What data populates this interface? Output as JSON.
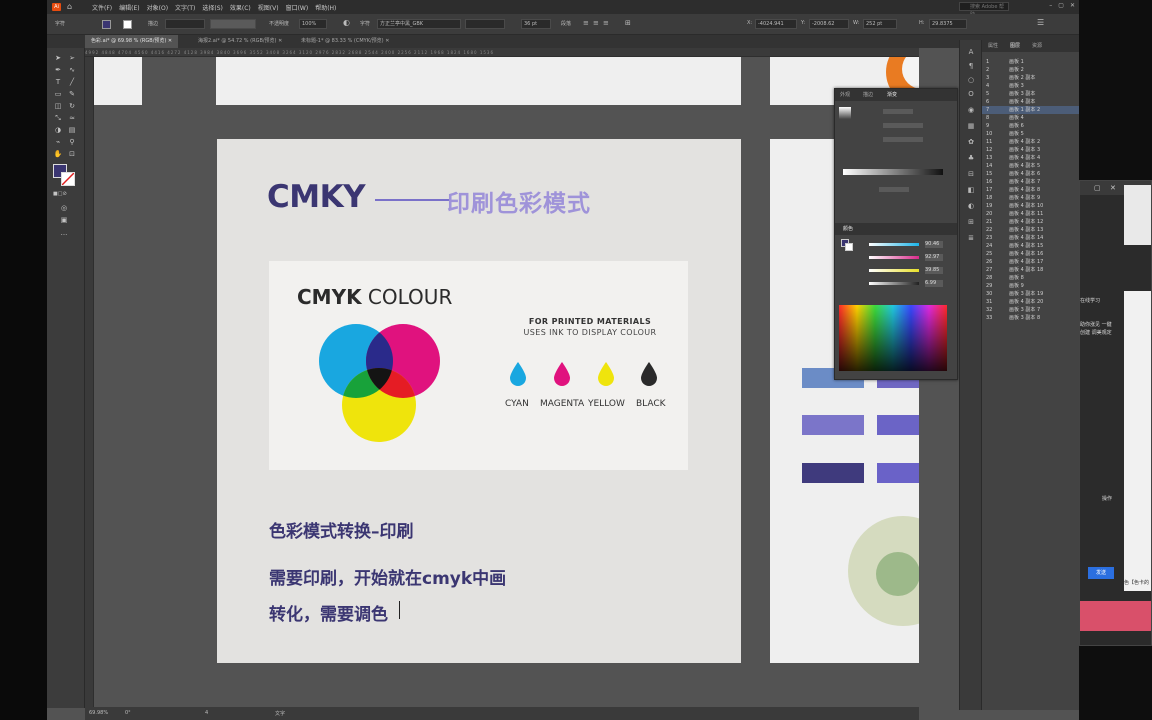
{
  "app": {
    "menus": [
      "文件(F)",
      "编辑(E)",
      "对象(O)",
      "文字(T)",
      "选择(S)",
      "效果(C)",
      "视图(V)",
      "窗口(W)",
      "帮助(H)"
    ],
    "search_placeholder": "搜索 Adobe 帮助",
    "control_bar": {
      "type_label": "字符",
      "stroke_label": "描边",
      "opacity_label": "不透明度",
      "opacity_value": "100%",
      "char_label": "字符",
      "font_value": "方正兰亭中黑_GBK",
      "font_size": "36 pt",
      "paragraph_label": "段落",
      "x_value": "-4024.941",
      "y_value": "-2008.62",
      "w_value": "252 pt",
      "h_value": "29.8375"
    },
    "tabs": [
      {
        "label": "色彩.ai* @ 69.98 % (RGB/预览)",
        "active": true
      },
      {
        "label": "海报2.ai* @ 54.72 % (RGB/预览)",
        "active": false
      },
      {
        "label": "未标题-1* @ 83.33 % (CMYK/预览)",
        "active": false
      }
    ],
    "ruler_ticks": "4992 4848 4704 4560 4416 4272 4128 3984 3840 3696 3552 3408 3264 3120 2976 2832 2688 2544 2400 2256 2112 1968 1824 1680 1536",
    "status": {
      "zoom": "69.98%",
      "angle": "0°",
      "page": "4",
      "mode": "文字"
    }
  },
  "artboard": {
    "title_en": "CMKY",
    "title_cn": "印刷色彩模式",
    "card": {
      "heading_bold": "CMYK",
      "heading_light": " COLOUR",
      "printed": "FOR PRINTED MATERIALS",
      "uses": "USES INK TO DISPLAY COLOUR",
      "drops": [
        {
          "label": "CYAN",
          "color": "#19a7e0"
        },
        {
          "label": "MAGENTA",
          "color": "#e0127e"
        },
        {
          "label": "YELLOW",
          "color": "#efe40c"
        },
        {
          "label": "BLACK",
          "color": "#2a2a2a"
        }
      ]
    },
    "lines": [
      "色彩模式转换–印刷",
      "需要印刷，开始就在cmyk中画",
      "转化，需要调色"
    ]
  },
  "color_panel": {
    "tabs": [
      "外观",
      "描边",
      "渐变"
    ],
    "color_tab": "颜色",
    "values": [
      "90.46",
      "92.97",
      "39.85",
      "6.99"
    ],
    "colors": {
      "c": "#1bb4e8",
      "m": "#d92a8a",
      "y": "#e8e02a",
      "k": "#222222"
    }
  },
  "layers_panel": {
    "tabs": [
      "属性",
      "图层",
      "资源"
    ],
    "rows": [
      {
        "n": "1",
        "name": "画板 1"
      },
      {
        "n": "2",
        "name": "画板 2"
      },
      {
        "n": "3",
        "name": "画板 2 副本"
      },
      {
        "n": "4",
        "name": "画板 3"
      },
      {
        "n": "5",
        "name": "画板 3 副本"
      },
      {
        "n": "6",
        "name": "画板 4 副本"
      },
      {
        "n": "7",
        "name": "画板 1 副本 2"
      },
      {
        "n": "8",
        "name": "画板 4"
      },
      {
        "n": "9",
        "name": "画板 6"
      },
      {
        "n": "10",
        "name": "画板 5"
      },
      {
        "n": "11",
        "name": "画板 4 副本 2"
      },
      {
        "n": "12",
        "name": "画板 4 副本 3"
      },
      {
        "n": "13",
        "name": "画板 4 副本 4"
      },
      {
        "n": "14",
        "name": "画板 4 副本 5"
      },
      {
        "n": "15",
        "name": "画板 4 副本 6"
      },
      {
        "n": "16",
        "name": "画板 4 副本 7"
      },
      {
        "n": "17",
        "name": "画板 4 副本 8"
      },
      {
        "n": "18",
        "name": "画板 4 副本 9"
      },
      {
        "n": "19",
        "name": "画板 4 副本 10"
      },
      {
        "n": "20",
        "name": "画板 4 副本 11"
      },
      {
        "n": "21",
        "name": "画板 4 副本 12"
      },
      {
        "n": "22",
        "name": "画板 4 副本 13"
      },
      {
        "n": "23",
        "name": "画板 4 副本 14"
      },
      {
        "n": "24",
        "name": "画板 4 副本 15"
      },
      {
        "n": "25",
        "name": "画板 4 副本 16"
      },
      {
        "n": "26",
        "name": "画板 4 副本 17"
      },
      {
        "n": "27",
        "name": "画板 4 副本 18"
      },
      {
        "n": "28",
        "name": "画板 8"
      },
      {
        "n": "29",
        "name": "画板 9"
      },
      {
        "n": "30",
        "name": "画板 3 副本 19"
      },
      {
        "n": "31",
        "name": "画板 4 副本 20"
      },
      {
        "n": "32",
        "name": "画板 3 副本 7"
      },
      {
        "n": "33",
        "name": "画板 3 副本 8"
      }
    ]
  },
  "browser": {
    "text1": "在线学习",
    "text2": "助你涨见 一键创建 调美观定",
    "text3": "操作",
    "send": "发送",
    "foot": "色【色卡的"
  },
  "swatch_colors": {
    "light_blue": "#6b8cc6",
    "mid_purple": "#6f67c2",
    "dark_purple": "#3f3a7d",
    "green_outer": "#d5dbbf",
    "green_inner": "#9db98a"
  }
}
